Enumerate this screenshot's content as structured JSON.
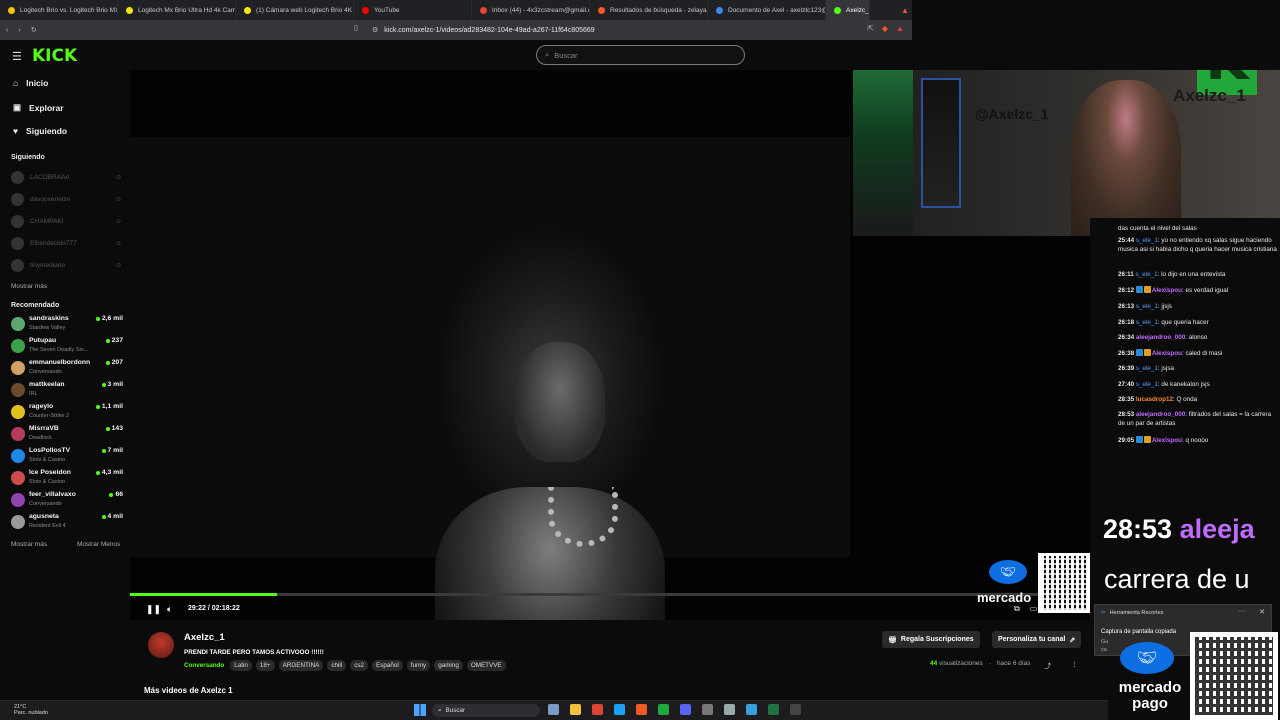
{
  "browser": {
    "tabs": [
      {
        "label": "Logitech Brio vs. Logitech Brio MX -",
        "color": "#ffc107"
      },
      {
        "label": "Logitech Mx Brio Ultra Hd 4k Camara",
        "color": "#ffe600"
      },
      {
        "label": "(1) Cámara web Logitech Brio 4K 90f",
        "color": "#ffe600"
      },
      {
        "label": "YouTube",
        "color": "#ff0000"
      },
      {
        "label": "Inbox (44) - 4x3zcstream@gmail.com",
        "color": "#ea4335"
      },
      {
        "label": "Resultados de búsqueda - zelayaaxe",
        "color": "#ff5722"
      },
      {
        "label": "Documento de Axel - axelztc123@g",
        "color": "#4285f4"
      },
      {
        "label": "Axelzc_1",
        "color": "#53fc18"
      }
    ],
    "url": "kick.com/axelzc-1/videos/ad283482-104e-49ad-a267-11f64c805669"
  },
  "header": {
    "logo": "KICK",
    "search_placeholder": "Buscar"
  },
  "sidebar": {
    "nav": [
      "Inicio",
      "Explorar",
      "Siguiendo"
    ],
    "following_title": "Siguiendo",
    "following": [
      "LACOBRAAA",
      "davooxeneize",
      "CHAMPAKI",
      "Elbendecido777",
      "tinymediano"
    ],
    "show_more": "Mostrar más",
    "recommended_title": "Recomendado",
    "recommended": [
      {
        "name": "sandraskins",
        "category": "Stardew Valley",
        "viewers": "2,6 mil",
        "color": "#5aa870"
      },
      {
        "name": "Putupau",
        "category": "The Seven Deadly Sin...",
        "viewers": "237",
        "color": "#3aa34a"
      },
      {
        "name": "emmanuelbordonn",
        "category": "Conversando",
        "viewers": "207",
        "color": "#d2a066"
      },
      {
        "name": "mattkeelan",
        "category": "IRL",
        "viewers": "3 mil",
        "color": "#6b4a2e"
      },
      {
        "name": "rageylo",
        "category": "Counter-Strike 2",
        "viewers": "1,1 mil",
        "color": "#e0c020"
      },
      {
        "name": "MisrraVB",
        "category": "Deadlock",
        "viewers": "143",
        "color": "#b43c5a"
      },
      {
        "name": "LosPollosTV",
        "category": "Slots & Casino",
        "viewers": "7 mil",
        "color": "#1e88e5"
      },
      {
        "name": "Ice Poseidon",
        "category": "Slots & Casino",
        "viewers": "4,3 mil",
        "color": "#d04a4a"
      },
      {
        "name": "feer_villalvaxo",
        "category": "Conversando",
        "viewers": "66",
        "color": "#8e44ad"
      },
      {
        "name": "agusneta",
        "category": "Resident Evil 4",
        "viewers": "4 mil",
        "color": "#999999"
      }
    ],
    "show_more_bottom": "Mostrar más",
    "show_less": "Mostrar Menos"
  },
  "player": {
    "time": "29:22 / 02:18:22",
    "progress": 0.1535
  },
  "webcam": {
    "handle": "@Axelzc_1",
    "name": "Axelzc_1",
    "k": "K"
  },
  "chat": [
    {
      "time": "",
      "user": "",
      "text": "das cuenta el nivel del salas",
      "style": "u1",
      "badges": 0
    },
    {
      "time": "25:44",
      "user": "s_ele_1",
      "text": ": yo no entiendo xq salas sigue haciendo musica asi si habia dicho q queria hacer musica cristiana",
      "style": "u1",
      "badges": 0
    },
    {
      "time": "26:11",
      "user": "s_ele_1",
      "text": ": lo dijo en una entevista",
      "style": "u1",
      "badges": 0
    },
    {
      "time": "26:12",
      "user": "Alexispou",
      "text": ": es verdad igual",
      "style": "u2",
      "badges": 2
    },
    {
      "time": "26:13",
      "user": "s_ele_1",
      "text": ": jjsjs",
      "style": "u1",
      "badges": 0
    },
    {
      "time": "26:18",
      "user": "s_ele_1",
      "text": ": que queria hacer",
      "style": "u1",
      "badges": 0
    },
    {
      "time": "26:34",
      "user": "aleejandroo_000",
      "text": ": alonso",
      "style": "u2",
      "badges": 0
    },
    {
      "time": "26:38",
      "user": "Alexispou",
      "text": ": caled di masi",
      "style": "u2",
      "badges": 2
    },
    {
      "time": "26:39",
      "user": "s_ele_1",
      "text": ": jsjsa",
      "style": "u1",
      "badges": 0
    },
    {
      "time": "27:40",
      "user": "s_ele_1",
      "text": ": de kanekalon jsjs",
      "style": "u1",
      "badges": 0
    },
    {
      "time": "28:35",
      "user": "lucasdrop12",
      "text": ": Q onda",
      "style": "u3",
      "badges": 0
    },
    {
      "time": "28:53",
      "user": "aleejandroo_000",
      "text": ": filtrados del salas = la carrera de un par de artistas",
      "style": "u2",
      "badges": 0
    },
    {
      "time": "29:05",
      "user": "Alexispou",
      "text": ": q noooo",
      "style": "u2",
      "badges": 2
    }
  ],
  "big_overlay": {
    "time": "28:53",
    "user": "aleeja",
    "line": "carrera de u"
  },
  "mercado": {
    "line1": "mercado",
    "line2": "pago"
  },
  "toast": {
    "title": "Herramienta Recortes",
    "message": "Captura de pantalla copiada",
    "sub1": "Gu",
    "sub2": "ca"
  },
  "channel": {
    "name": "Axelzc_1",
    "title": "PRENDI TARDE PERO TAMOS ACTIVOOO !!!!!!",
    "category": "Conversando",
    "tags": [
      "Latin",
      "18+",
      "ARGENTINA",
      "chill",
      "cs2",
      "Español",
      "funny",
      "gaming",
      "OMETVVE"
    ],
    "gift_button": "Regala Suscripciones",
    "customize_button": "Personaliza tu canal",
    "views_count": "44",
    "views_label": "visualizaciones",
    "ago": "hace 6 días",
    "more_videos": "Más videos de Axelzc 1"
  },
  "taskbar": {
    "temp": "21°C",
    "weather": "Parc. nublado",
    "search": "Buscar"
  }
}
